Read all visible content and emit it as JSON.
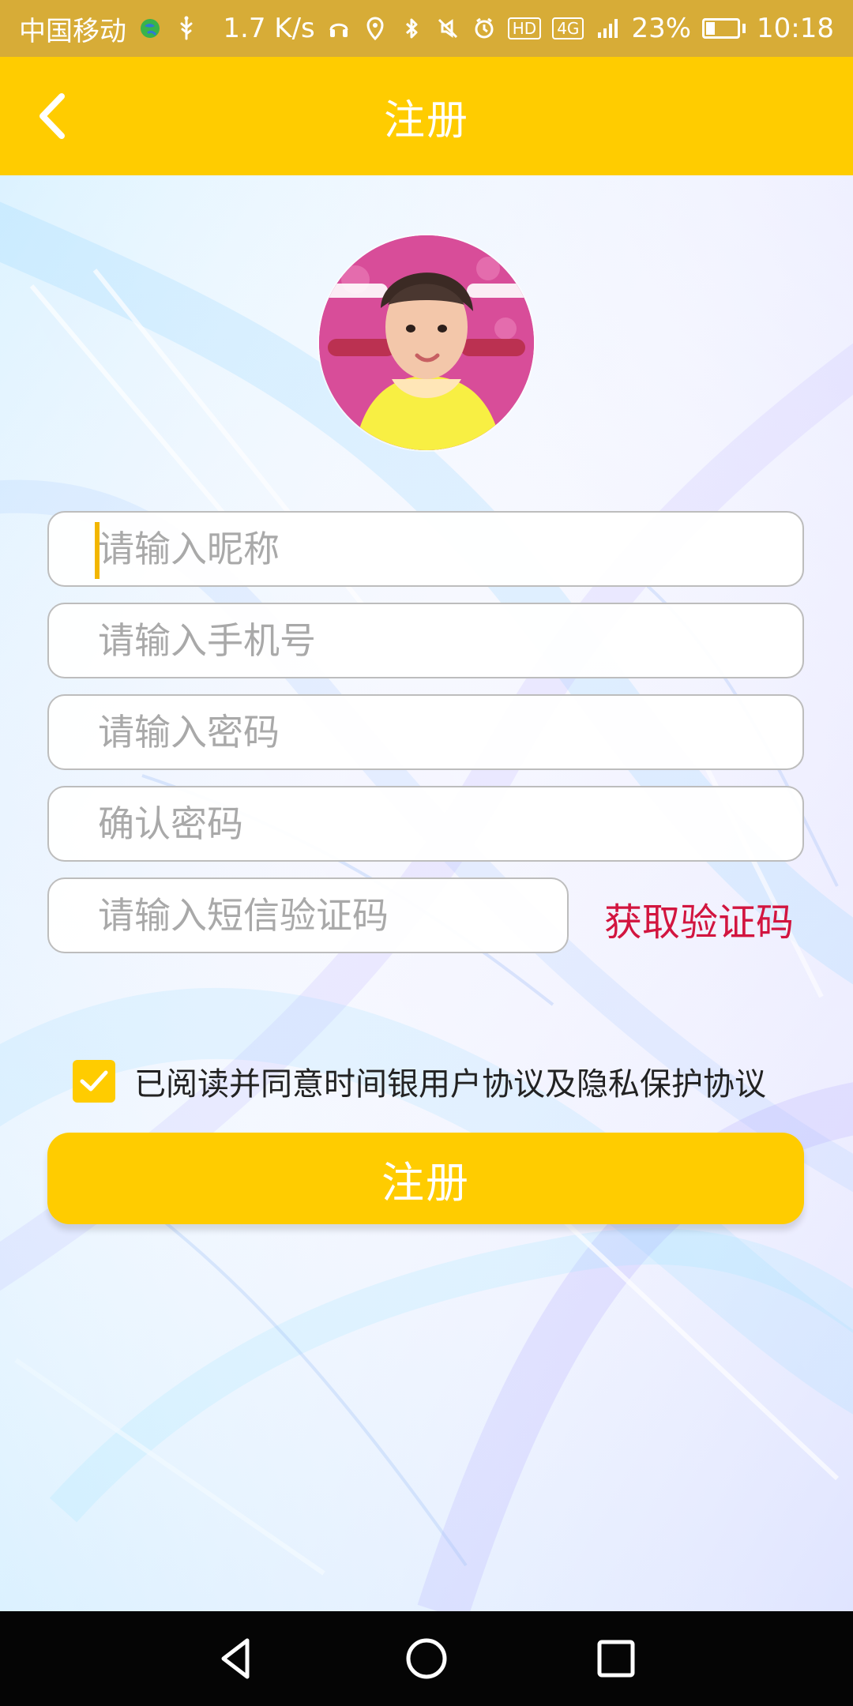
{
  "status_bar": {
    "carrier": "中国移动",
    "speed": "1.7 K/s",
    "hd_badge": "HD",
    "network_badge": "4G",
    "battery": "23%",
    "time": "10:18"
  },
  "header": {
    "title": "注册",
    "back_icon": "chevron-left-icon"
  },
  "form": {
    "nickname_placeholder": "请输入昵称",
    "phone_placeholder": "请输入手机号",
    "password_placeholder": "请输入密码",
    "confirm_placeholder": "确认密码",
    "sms_placeholder": "请输入短信验证码",
    "get_code_label": "获取验证码"
  },
  "agreement": {
    "checked": true,
    "text": "已阅读并同意时间银用户协议及隐私保护协议"
  },
  "submit": {
    "label": "注册"
  },
  "colors": {
    "status_bar": "#d7ac37",
    "accent": "#ffcc00",
    "link": "#d2153f"
  }
}
